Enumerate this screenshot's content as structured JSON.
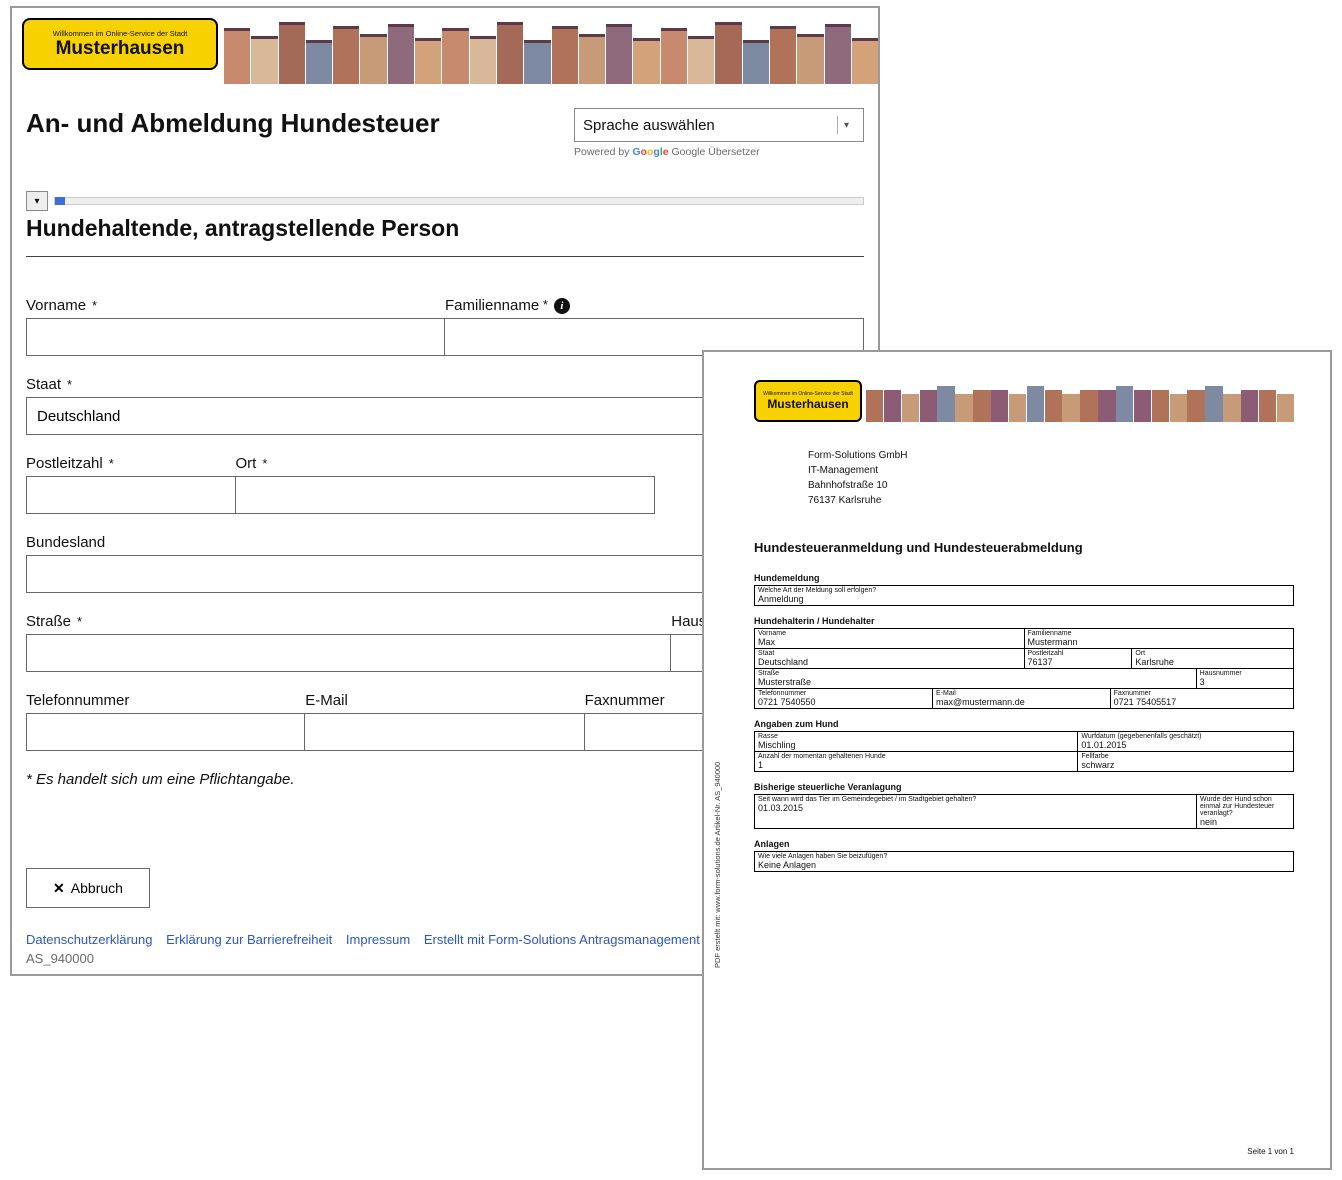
{
  "city_sign": {
    "small": "Willkommen im Online-Service der Stadt",
    "big": "Musterhausen"
  },
  "form": {
    "title": "An- und Abmeldung Hundesteuer",
    "lang_select_placeholder": "Sprache auswählen",
    "powered_prefix": "Powered by ",
    "google_letters": [
      "G",
      "o",
      "o",
      "g",
      "l",
      "e"
    ],
    "google_translate": "Google Übersetzer",
    "step_title": "Hundehaltende, antragstellende Person",
    "labels": {
      "vorname": "Vorname",
      "familienname": "Familienname",
      "staat": "Staat",
      "plz": "Postleitzahl",
      "ort": "Ort",
      "bundesland": "Bundesland",
      "strasse": "Straße",
      "hausnummer": "Hausnummer",
      "telefon": "Telefonnummer",
      "email": "E-Mail",
      "fax": "Faxnummer"
    },
    "values": {
      "staat": "Deutschland"
    },
    "mandatory_note": "* Es handelt sich um eine Pflichtangabe.",
    "abort": "Abbruch",
    "footer_links": [
      "Datenschutzerklärung",
      "Erklärung zur Barrierefreiheit",
      "Impressum",
      "Erstellt mit Form-Solutions Antragsmanagement"
    ],
    "footer_code": "AS_940000"
  },
  "pdf": {
    "address": [
      "Form-Solutions GmbH",
      "IT-Management",
      "Bahnhofstraße 10",
      "76137 Karlsruhe"
    ],
    "title": "Hundesteueranmeldung und Hundesteuerabmeldung",
    "sections": {
      "hundemeldung": {
        "heading": "Hundemeldung",
        "q": "Welche Art der Meldung soll erfolgen?",
        "a": "Anmeldung"
      },
      "halter": {
        "heading": "Hundehalterin / Hundehalter",
        "vorname_l": "Vorname",
        "vorname_v": "Max",
        "familienname_l": "Familienname",
        "familienname_v": "Mustermann",
        "staat_l": "Staat",
        "staat_v": "Deutschland",
        "plz_l": "Postleitzahl",
        "plz_v": "76137",
        "ort_l": "Ort",
        "ort_v": "Karlsruhe",
        "strasse_l": "Straße",
        "strasse_v": "Musterstraße",
        "hausnr_l": "Hausnummer",
        "hausnr_v": "3",
        "tel_l": "Telefonnummer",
        "tel_v": "0721 7540550",
        "email_l": "E-Mail",
        "email_v": "max@mustermann.de",
        "fax_l": "Faxnummer",
        "fax_v": "0721 75405517"
      },
      "hund": {
        "heading": "Angaben zum Hund",
        "rasse_l": "Rasse",
        "rasse_v": "Mischling",
        "wurf_l": "Wurfdatum (gegebenenfalls geschätzt)",
        "wurf_v": "01.01.2015",
        "anzahl_l": "Anzahl der momentan gehaltenen Hunde",
        "anzahl_v": "1",
        "fell_l": "Fellfarbe",
        "fell_v": "schwarz"
      },
      "veranlagung": {
        "heading": "Bisherige steuerliche Veranlagung",
        "seit_l": "Seit wann wird das Tier im Gemeindegebiet / im Stadtgebiet gehalten?",
        "seit_v": "01.03.2015",
        "wurde_l": "Wurde der Hund schon einmal zur Hundesteuer veranlagt?",
        "wurde_v": "nein"
      },
      "anlagen": {
        "heading": "Anlagen",
        "q": "Wie viele Anlagen haben Sie beizufügen?",
        "a": "Keine Anlagen"
      }
    },
    "side_text": "PDF erstellt mit: www.form-solutions.de   Artikel-Nr. AS_940000",
    "page_num": "Seite 1 von 1"
  }
}
